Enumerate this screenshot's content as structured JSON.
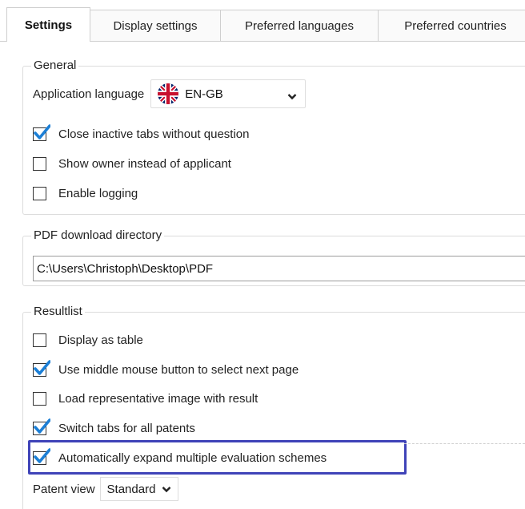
{
  "tabs": [
    {
      "label": "Settings"
    },
    {
      "label": "Display settings"
    },
    {
      "label": "Preferred languages"
    },
    {
      "label": "Preferred countries"
    }
  ],
  "general": {
    "legend": "General",
    "app_language_label": "Application language",
    "app_language_value": "EN-GB",
    "options": [
      {
        "label": "Close inactive tabs without question",
        "checked": true
      },
      {
        "label": "Show owner instead of applicant",
        "checked": false
      },
      {
        "label": "Enable logging",
        "checked": false
      }
    ]
  },
  "pdf": {
    "legend": "PDF download directory",
    "path": "C:\\Users\\Christoph\\Desktop\\PDF"
  },
  "resultlist": {
    "legend": "Resultlist",
    "options": [
      {
        "label": "Display as table",
        "checked": false
      },
      {
        "label": "Use middle mouse button to select next page",
        "checked": true
      },
      {
        "label": "Load representative image with result",
        "checked": false
      },
      {
        "label": "Switch tabs for all patents",
        "checked": true
      },
      {
        "label": "Automatically expand multiple evaluation schemes",
        "checked": true
      }
    ],
    "patent_view_label": "Patent view",
    "patent_view_value": "Standard"
  },
  "colors": {
    "check_blue": "#1c7fd6",
    "highlight": "#3f43b8"
  }
}
